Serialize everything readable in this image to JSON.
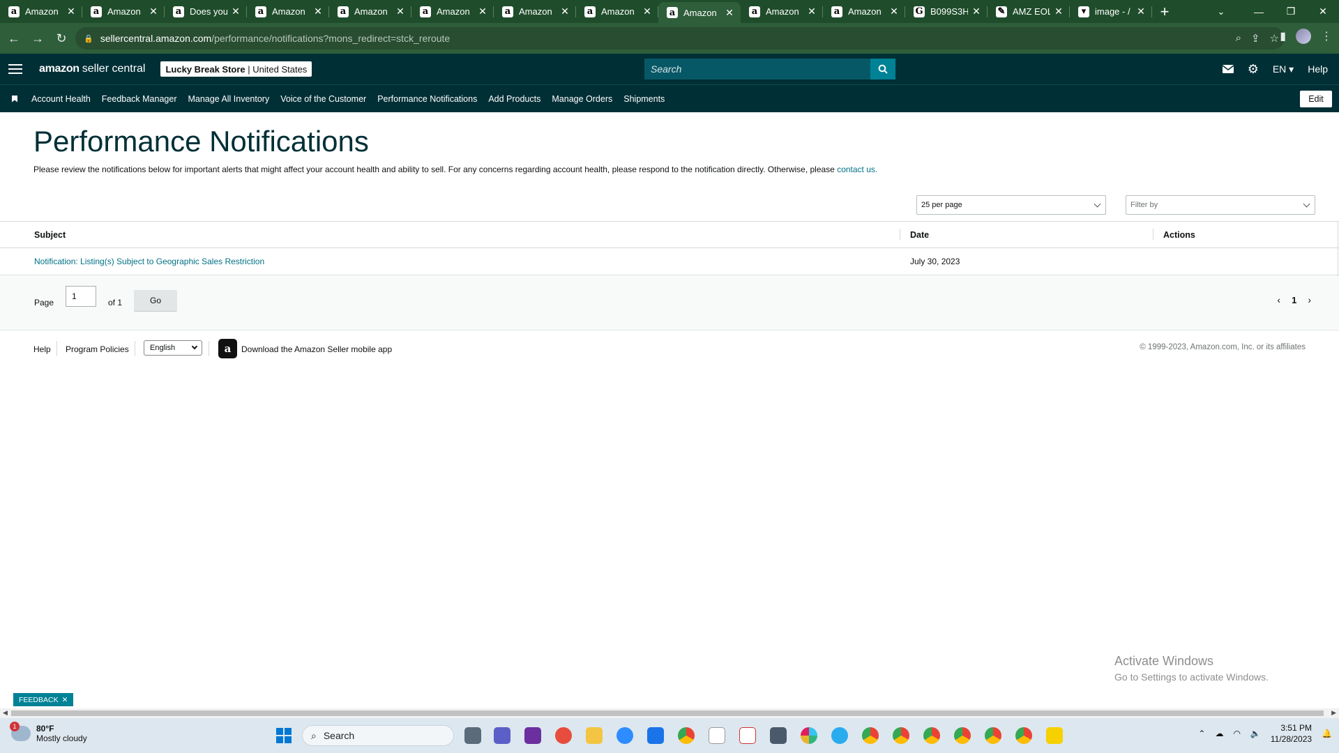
{
  "browser": {
    "tabs": [
      {
        "title": "Amazon",
        "favicon": "a",
        "active": false
      },
      {
        "title": "Amazon",
        "favicon": "a",
        "active": false
      },
      {
        "title": "Does you",
        "favicon": "a",
        "active": false
      },
      {
        "title": "Amazon",
        "favicon": "a",
        "active": false
      },
      {
        "title": "Amazon",
        "favicon": "a",
        "active": false
      },
      {
        "title": "Amazon",
        "favicon": "a",
        "active": false
      },
      {
        "title": "Amazon",
        "favicon": "a",
        "active": false
      },
      {
        "title": "Amazon",
        "favicon": "a",
        "active": false
      },
      {
        "title": "Amazon",
        "favicon": "a",
        "active": true
      },
      {
        "title": "Amazon",
        "favicon": "a",
        "active": false
      },
      {
        "title": "Amazon",
        "favicon": "a",
        "active": false
      },
      {
        "title": "B099S3H",
        "favicon": "G",
        "active": false
      },
      {
        "title": "AMZ EOL",
        "favicon": "✎",
        "active": false
      },
      {
        "title": "image - /",
        "favicon": "▾",
        "active": false
      }
    ],
    "url_host": "sellercentral.amazon.com",
    "url_path": "/performance/notifications?mons_redirect=stck_reroute"
  },
  "header": {
    "logo_bold": "amazon",
    "logo_rest": "seller central",
    "store_name": "Lucky Break Store",
    "store_divider": " | ",
    "store_country": "United States",
    "search_placeholder": "Search",
    "language": "EN",
    "help": "Help"
  },
  "nav": {
    "links": [
      "Account Health",
      "Feedback Manager",
      "Manage All Inventory",
      "Voice of the Customer",
      "Performance Notifications",
      "Add Products",
      "Manage Orders",
      "Shipments"
    ],
    "edit": "Edit"
  },
  "page": {
    "title": "Performance Notifications",
    "intro": "Please review the notifications below for important alerts that might affect your account health and ability to sell. For any concerns regarding account health, please respond to the notification directly. Otherwise, please ",
    "intro_link": "contact us.",
    "per_page": "25 per page",
    "filter_placeholder": "Filter by"
  },
  "table": {
    "columns": {
      "subject": "Subject",
      "date": "Date",
      "actions": "Actions"
    },
    "rows": [
      {
        "subject": "Notification: Listing(s) Subject to Geographic Sales Restriction",
        "date": "July 30, 2023"
      }
    ]
  },
  "pager": {
    "page_label": "Page",
    "page_value": "1",
    "of_label": "of 1",
    "go": "Go",
    "current": "1"
  },
  "footer": {
    "help": "Help",
    "program_policies": "Program Policies",
    "language": "English",
    "download_app": "Download the Amazon Seller mobile app",
    "copyright": "© 1999-2023, Amazon.com, Inc. or its affiliates"
  },
  "overlay": {
    "activate_title": "Activate Windows",
    "activate_sub": "Go to Settings to activate Windows.",
    "feedback": "FEEDBACK"
  },
  "taskbar": {
    "weather_temp": "80°F",
    "weather_desc": "Mostly cloudy",
    "weather_badge": "1",
    "search": "Search",
    "time": "3:51 PM",
    "date": "11/28/2023"
  },
  "colors": {
    "header_bg": "#002f36",
    "link": "#007185",
    "browser_frame": "#1f4d2b",
    "search_button": "#008296"
  }
}
